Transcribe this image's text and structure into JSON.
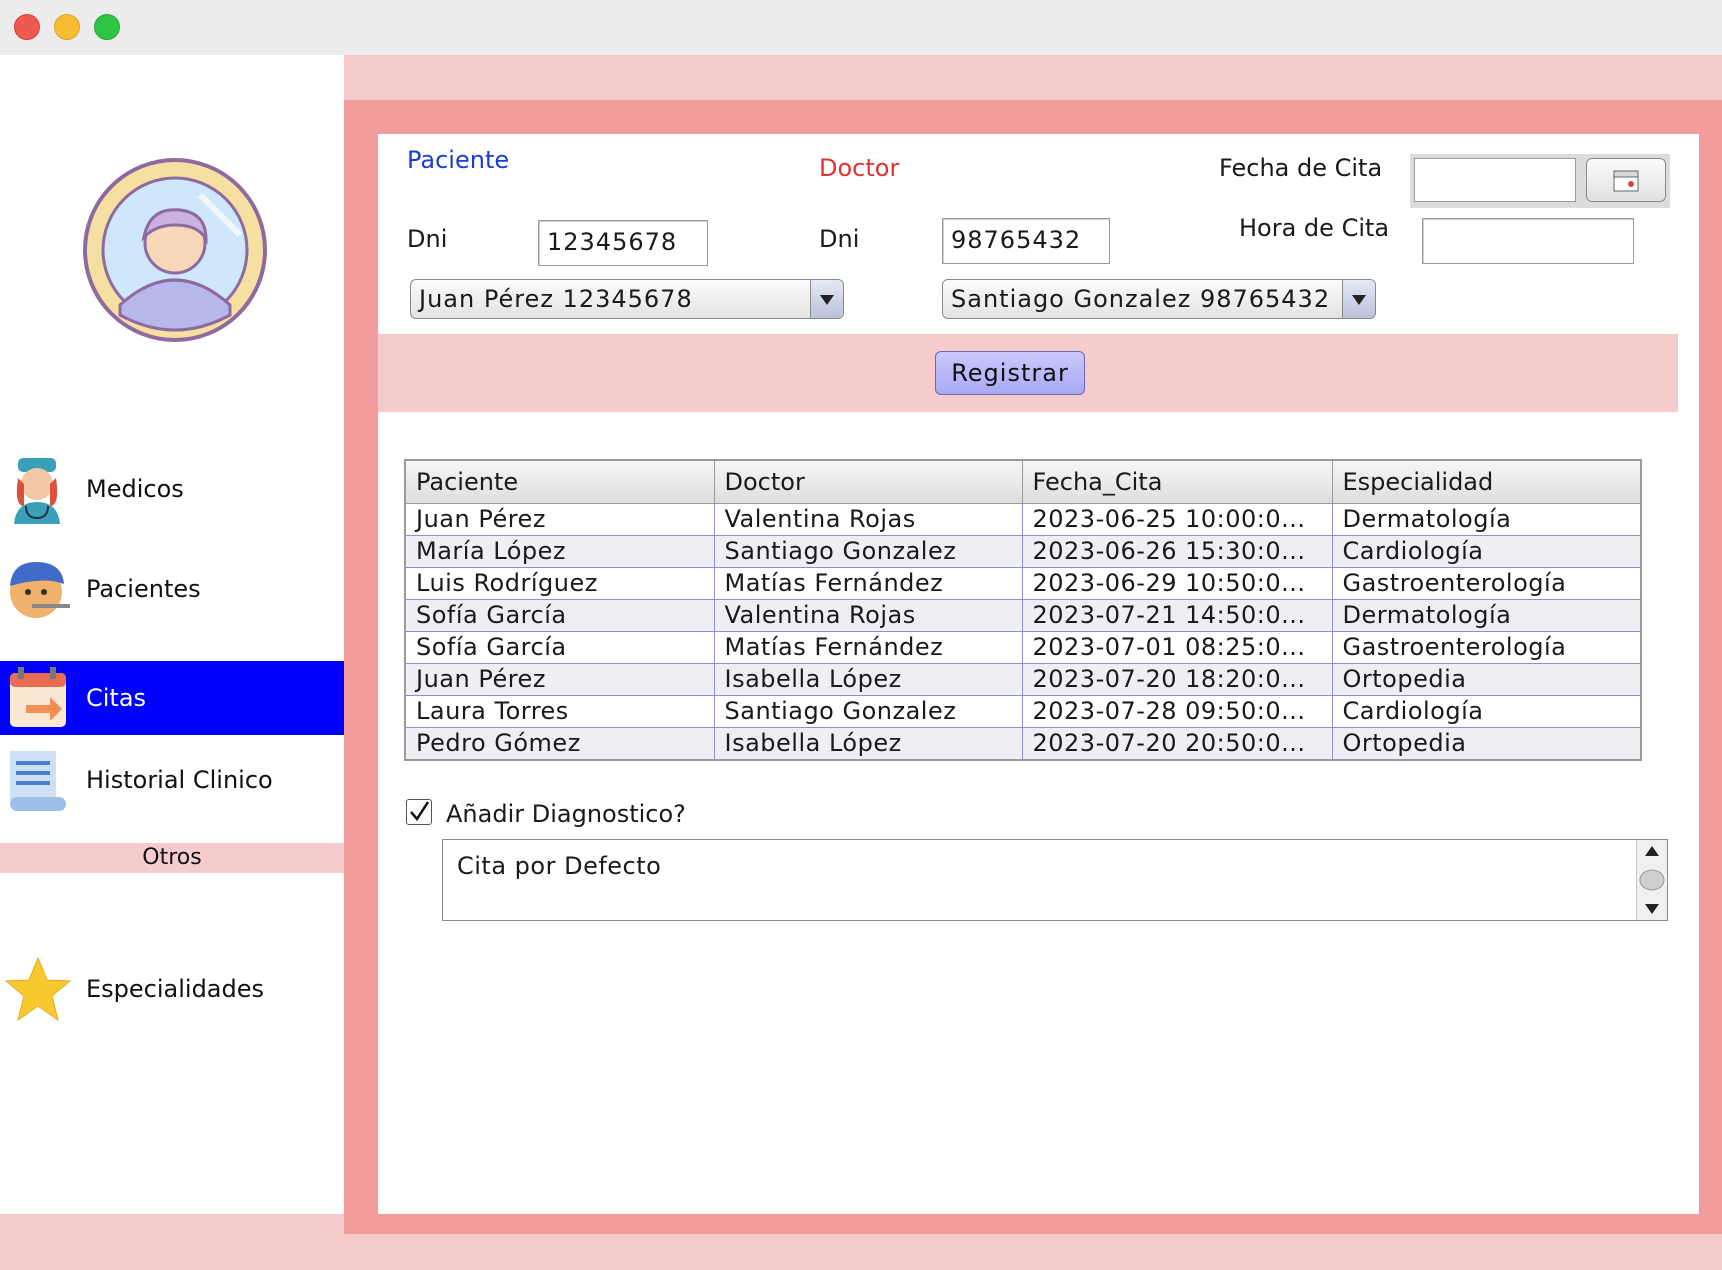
{
  "sidebar": {
    "items": [
      {
        "label": "Medicos",
        "icon": "doctor-icon"
      },
      {
        "label": "Pacientes",
        "icon": "patient-icon"
      },
      {
        "label": "Citas",
        "icon": "calendar-icon"
      },
      {
        "label": "Historial Clinico",
        "icon": "medical-record-icon"
      }
    ],
    "section_label": "Otros",
    "extra_items": [
      {
        "label": "Especialidades",
        "icon": "star-icon"
      }
    ],
    "active_item": "Citas",
    "active_color": "#0000ff"
  },
  "form": {
    "paciente_heading": "Paciente",
    "doctor_heading": "Doctor",
    "fecha_label": "Fecha de Cita",
    "hora_label": "Hora de Cita",
    "dni_label": "Dni",
    "paciente_dni": "12345678",
    "doctor_dni": "98765432",
    "paciente_select": "Juan Pérez 12345678",
    "doctor_select": "Santiago Gonzalez 98765432",
    "fecha_value": "",
    "hora_value": "",
    "register_button": "Registrar"
  },
  "table": {
    "columns": [
      "Paciente",
      "Doctor",
      "Fecha_Cita",
      "Especialidad"
    ],
    "rows": [
      [
        "Juan Pérez",
        "Valentina Rojas",
        "2023-06-25 10:00:0...",
        "Dermatología"
      ],
      [
        "María López",
        "Santiago Gonzalez",
        "2023-06-26 15:30:0...",
        "Cardiología"
      ],
      [
        "Luis Rodríguez",
        "Matías Fernández",
        "2023-06-29 10:50:0...",
        "Gastroenterología"
      ],
      [
        "Sofía García",
        "Valentina Rojas",
        "2023-07-21 14:50:0...",
        "Dermatología"
      ],
      [
        "Sofía García",
        "Matías Fernández",
        "2023-07-01 08:25:0...",
        "Gastroenterología"
      ],
      [
        "Juan Pérez",
        "Isabella López",
        "2023-07-20 18:20:0...",
        "Ortopedia"
      ],
      [
        "Laura Torres",
        "Santiago Gonzalez",
        "2023-07-28 09:50:0...",
        "Cardiología"
      ],
      [
        "Pedro Gómez",
        "Isabella López",
        "2023-07-20 20:50:0...",
        "Ortopedia"
      ]
    ]
  },
  "diagnostico": {
    "checkbox_label": "Añadir Diagnostico?",
    "checked": true,
    "text": "Cita por Defecto"
  },
  "colors": {
    "frame": "#f39c9c",
    "light_pink": "#f6cbcc",
    "paciente_heading": "#1a3cd6",
    "doctor_heading": "#e0322e",
    "register_button": "#b4b4f8"
  }
}
